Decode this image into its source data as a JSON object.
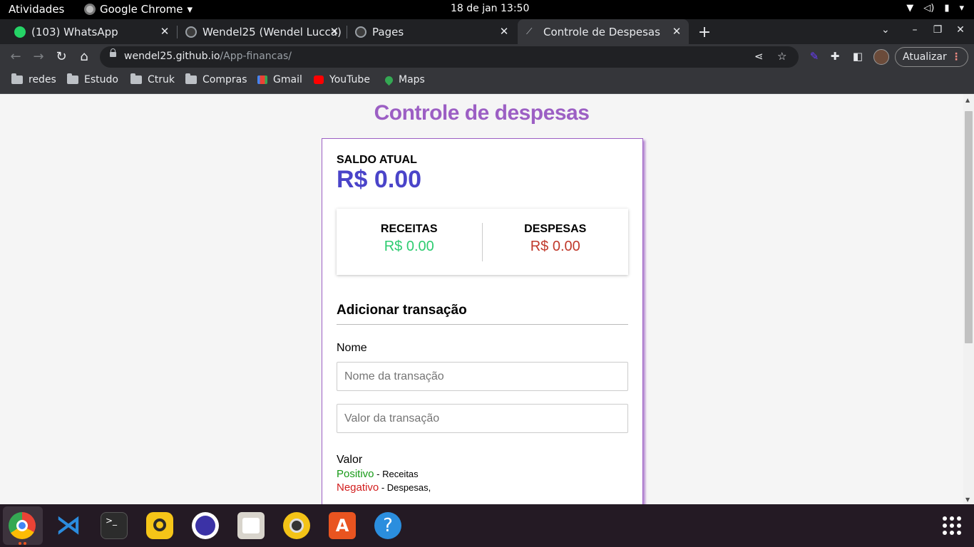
{
  "topbar": {
    "activities": "Atividades",
    "app_name": "Google Chrome",
    "clock": "18 de jan  13:50",
    "update_label": "Atualizar"
  },
  "tabs": [
    {
      "title": "(103) WhatsApp",
      "icon": "whatsapp-icon",
      "active": false
    },
    {
      "title": "Wendel25 (Wendel Lucca)",
      "icon": "github-icon",
      "active": false
    },
    {
      "title": "Pages",
      "icon": "github-icon",
      "active": false
    },
    {
      "title": "Controle de Despesas",
      "icon": "pen-icon",
      "active": true
    }
  ],
  "omnibox": {
    "host": "wendel25.github.io",
    "path": "/App-financas/"
  },
  "bookmarks": [
    {
      "label": "redes",
      "icon": "folder-icon"
    },
    {
      "label": "Estudo",
      "icon": "folder-icon"
    },
    {
      "label": "Ctruk",
      "icon": "folder-icon"
    },
    {
      "label": "Compras",
      "icon": "folder-icon"
    },
    {
      "label": "Gmail",
      "icon": "gmail-icon"
    },
    {
      "label": "YouTube",
      "icon": "youtube-icon"
    },
    {
      "label": "Maps",
      "icon": "maps-icon"
    }
  ],
  "page": {
    "title": "Controle de despesas",
    "saldo_label": "SALDO ATUAL",
    "saldo_value": "R$ 0.00",
    "receitas_label": "RECEITAS",
    "receitas_value": "R$ 0.00",
    "despesas_label": "DESPESAS",
    "despesas_value": "R$ 0.00",
    "add_title": "Adicionar transação",
    "nome_label": "Nome",
    "nome_placeholder": "Nome da transação",
    "valor_placeholder": "Valor da transação",
    "valor_label": "Valor",
    "positivo": "Positivo",
    "positivo_desc": " - Receitas",
    "negativo": "Negativo",
    "negativo_desc": " - Despesas,"
  },
  "colors": {
    "title_purple": "#9c5fc4",
    "saldo_blue": "#4a44c9",
    "receitas_green": "#2ecc71",
    "despesas_red": "#c0392b"
  },
  "dock": [
    "chrome-icon",
    "vscode-icon",
    "terminal-icon",
    "beekeeper-icon",
    "eclipse-icon",
    "files-icon",
    "rhythmbox-icon",
    "software-store-icon",
    "help-icon"
  ]
}
